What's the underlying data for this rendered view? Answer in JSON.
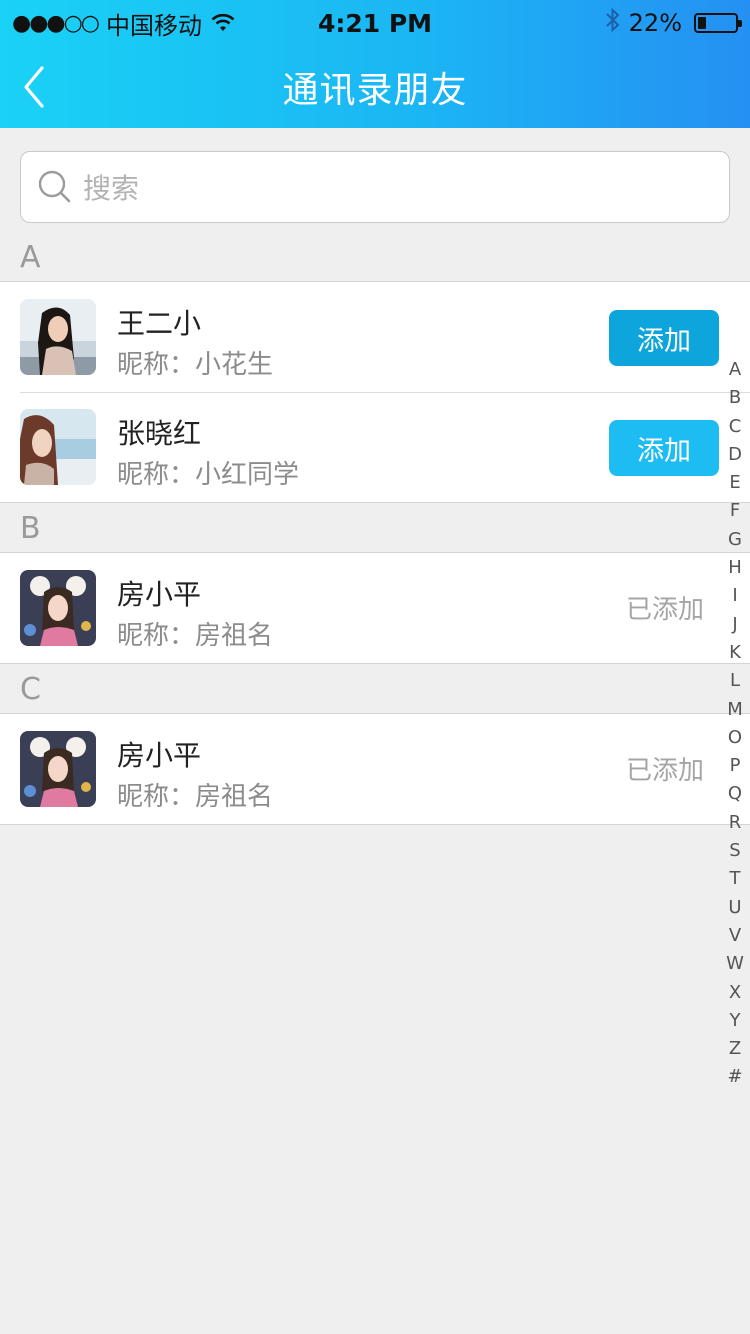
{
  "status_bar": {
    "signal": "●●●○○",
    "carrier": "中国移动",
    "time": "4:21 PM",
    "battery_text": "22%",
    "battery_level": 0.22
  },
  "nav": {
    "title": "通讯录朋友"
  },
  "search": {
    "placeholder": "搜索"
  },
  "colors": {
    "accent_primary": "#0ea5dc",
    "accent_secondary": "#1dbcf2",
    "header_gradient_start": "#1ad2f5",
    "header_gradient_end": "#2590f3"
  },
  "sections": [
    {
      "letter": "A",
      "contacts": [
        {
          "name": "王二小",
          "nickname": "昵称：小花生",
          "action": "添加",
          "added": false,
          "button_color": "#0ea5dc",
          "avatar": "beach-portrait"
        },
        {
          "name": "张晓红",
          "nickname": "昵称：小红同学",
          "action": "添加",
          "added": false,
          "button_color": "#1dbcf2",
          "avatar": "sea-portrait"
        }
      ]
    },
    {
      "letter": "B",
      "contacts": [
        {
          "name": "房小平",
          "nickname": "昵称：房祖名",
          "action": "已添加",
          "added": true,
          "avatar": "headband-portrait"
        }
      ]
    },
    {
      "letter": "C",
      "contacts": [
        {
          "name": "房小平",
          "nickname": "昵称：房祖名",
          "action": "已添加",
          "added": true,
          "avatar": "headband-portrait"
        }
      ]
    }
  ],
  "index_letters": [
    "A",
    "B",
    "C",
    "D",
    "E",
    "F",
    "G",
    "H",
    "I",
    "J",
    "K",
    "L",
    "M",
    "O",
    "P",
    "Q",
    "R",
    "S",
    "T",
    "U",
    "V",
    "W",
    "X",
    "Y",
    "Z",
    "#"
  ]
}
